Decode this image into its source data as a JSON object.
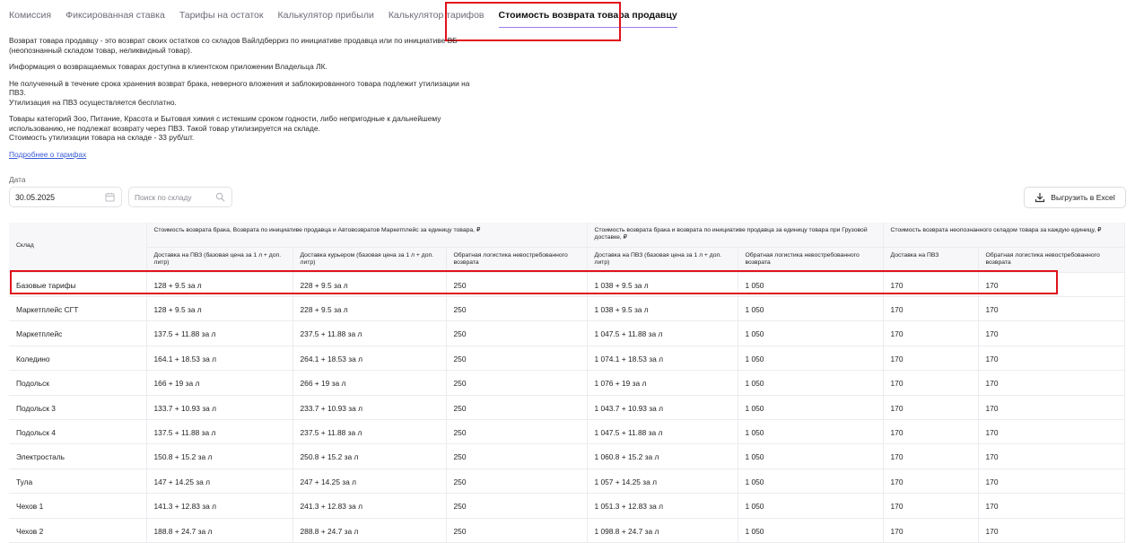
{
  "tabs": [
    {
      "label": "Комиссия",
      "active": false
    },
    {
      "label": "Фиксированная ставка",
      "active": false
    },
    {
      "label": "Тарифы на остаток",
      "active": false
    },
    {
      "label": "Калькулятор прибыли",
      "active": false
    },
    {
      "label": "Калькулятор тарифов",
      "active": false
    },
    {
      "label": "Стоимость возврата товара продавцу",
      "active": true
    }
  ],
  "description": {
    "p1": "Возврат товара продавцу - это возврат своих остатков со складов Вайлдберриз по инициативе продавца или по инициативе ВБ (неопознанный складом товар, неликвидный товар).",
    "p2": "Информация о возвращаемых товарах доступна в клиентском приложении Владельца ЛК.",
    "p3": "Не полученный в течение срока хранения возврат брака, неверного вложения и заблокированного товара подлежит утилизации на ПВЗ.",
    "p3b": "Утилизация на ПВЗ осуществляется бесплатно.",
    "p4": "Товары категорий Зоо, Питание, Красота и Бытовая химия с истекшим сроком годности, либо непригодные к дальнейшему использованию, не подлежат возврату через ПВЗ. Такой товар утилизируется на складе.",
    "p4b": "Стоимость утилизации товара на складе - 33 руб/шт.",
    "more_link": "Подробнее о тарифах"
  },
  "filters": {
    "date_label": "Дата",
    "date_value": "30.05.2025",
    "search_placeholder": "Поиск по складу",
    "export_label": "Выгрузить в Excel"
  },
  "table": {
    "col_sklad": "Склад",
    "group1": "Стоимость возврата брака, Возврата по инициативе продавца и Автовозвратов Маркетплейс за единицу товара, ₽",
    "group2": "Стоимость возврата брака и возврата по инициативе продавца за единицу товара при Грузовой доставке, ₽",
    "group3": "Стоимость возврата неопознанного складом товара за каждую единицу, ₽",
    "sub_headers": [
      "Доставка на ПВЗ (базовая цена за 1 л + доп. литр)",
      "Доставка курьером (базовая цена за 1 л + доп. литр)",
      "Обратная логистика невостребованного возврата",
      "Доставка на ПВЗ (базовая цена за 1 л + доп. литр)",
      "Обратная логистика невостребованного возврата",
      "Доставка на ПВЗ",
      "Обратная логистика невостребованного возврата"
    ],
    "rows": [
      [
        "Базовые тарифы",
        "128 + 9.5 за л",
        "228 + 9.5 за л",
        "250",
        "1 038 + 9.5 за л",
        "1 050",
        "170",
        "170"
      ],
      [
        "Маркетплейс СГТ",
        "128 + 9.5 за л",
        "228 + 9.5 за л",
        "250",
        "1 038 + 9.5 за л",
        "1 050",
        "170",
        "170"
      ],
      [
        "Маркетплейс",
        "137.5 + 11.88 за л",
        "237.5 + 11.88 за л",
        "250",
        "1 047.5 + 11.88 за л",
        "1 050",
        "170",
        "170"
      ],
      [
        "Коледино",
        "164.1 + 18.53 за л",
        "264.1 + 18.53 за л",
        "250",
        "1 074.1 + 18.53 за л",
        "1 050",
        "170",
        "170"
      ],
      [
        "Подольск",
        "166 + 19 за л",
        "266 + 19 за л",
        "250",
        "1 076 + 19 за л",
        "1 050",
        "170",
        "170"
      ],
      [
        "Подольск 3",
        "133.7 + 10.93 за л",
        "233.7 + 10.93 за л",
        "250",
        "1 043.7 + 10.93 за л",
        "1 050",
        "170",
        "170"
      ],
      [
        "Подольск 4",
        "137.5 + 11.88 за л",
        "237.5 + 11.88 за л",
        "250",
        "1 047.5 + 11.88 за л",
        "1 050",
        "170",
        "170"
      ],
      [
        "Электросталь",
        "150.8 + 15.2 за л",
        "250.8 + 15.2 за л",
        "250",
        "1 060.8 + 15.2 за л",
        "1 050",
        "170",
        "170"
      ],
      [
        "Тула",
        "147 + 14.25 за л",
        "247 + 14.25 за л",
        "250",
        "1 057 + 14.25 за л",
        "1 050",
        "170",
        "170"
      ],
      [
        "Чехов 1",
        "141.3 + 12.83 за л",
        "241.3 + 12.83 за л",
        "250",
        "1 051.3 + 12.83 за л",
        "1 050",
        "170",
        "170"
      ],
      [
        "Чехов 2",
        "188.8 + 24.7 за л",
        "288.8 + 24.7 за л",
        "250",
        "1 098.8 + 24.7 за л",
        "1 050",
        "170",
        "170"
      ]
    ]
  },
  "colors": {
    "highlight": "#e0121b",
    "accent": "#9a7ef0",
    "link": "#3a5bd9"
  }
}
